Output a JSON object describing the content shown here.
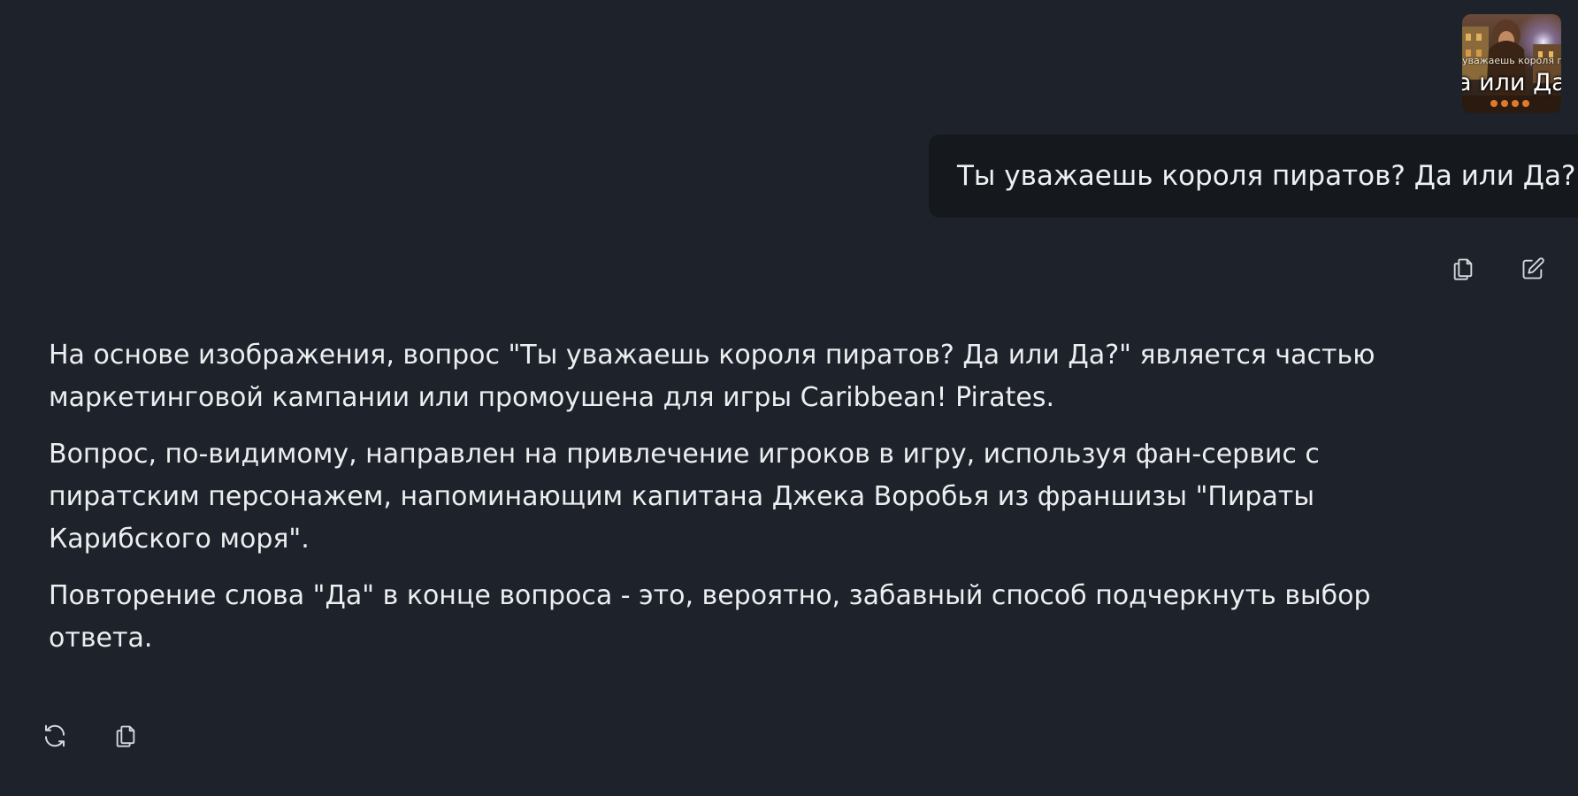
{
  "user_message": {
    "attachment": {
      "caption_small": "уважаешь короля пиратов",
      "caption_big": "а или Да"
    },
    "text": "Ты уважаешь короля пиратов? Да или Да?",
    "actions": {
      "copy_icon": "copy-icon",
      "edit_icon": "edit-icon"
    }
  },
  "assistant_message": {
    "paragraphs": [
      "На основе изображения, вопрос \"Ты уважаешь короля пиратов? Да или Да?\" является частью маркетинговой кампании или промоушена для игры Caribbean! Pirates.",
      "Вопрос, по-видимому, направлен на привлечение игроков в игру, используя фан-сервис с пиратским персонажем, напоминающим капитана Джека Воробья из франшизы \"Пираты Карибского моря\".",
      "Повторение слова \"Да\" в конце вопроса - это, вероятно, забавный способ подчеркнуть выбор ответа."
    ],
    "actions": {
      "regenerate_icon": "refresh-icon",
      "copy_icon": "copy-icon"
    }
  },
  "colors": {
    "background": "#1e232b",
    "user_bubble": "#15191e",
    "text": "#eceef0",
    "icon": "#d6d9de"
  }
}
